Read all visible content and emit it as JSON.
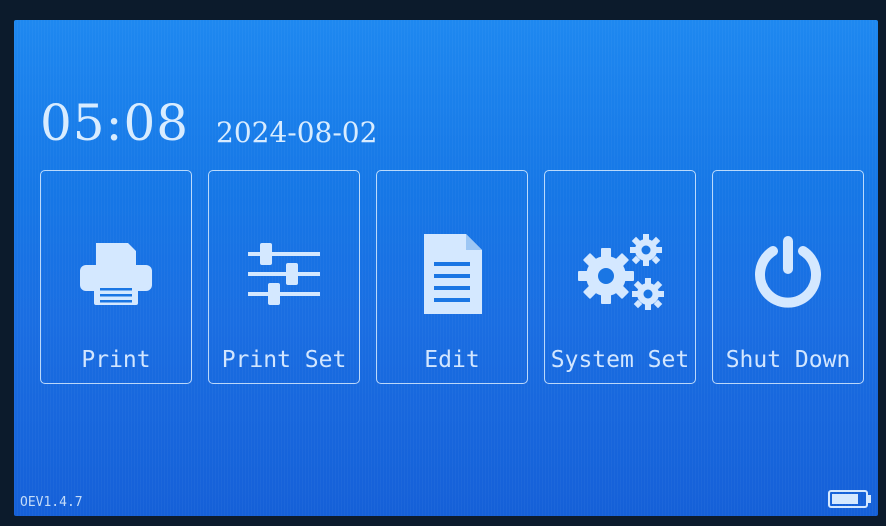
{
  "status": {
    "time": "05:08",
    "date": "2024-08-02",
    "version": "OEV1.4.7",
    "battery_icon": "battery-icon"
  },
  "menu": [
    {
      "label": "Print",
      "icon": "printer-icon"
    },
    {
      "label": "Print Set",
      "icon": "sliders-icon"
    },
    {
      "label": "Edit",
      "icon": "document-icon"
    },
    {
      "label": "System Set",
      "icon": "gears-icon"
    },
    {
      "label": "Shut Down",
      "icon": "power-icon"
    }
  ],
  "colors": {
    "screen_top": "#1e88f0",
    "screen_bottom": "#1560d8",
    "foreground": "#d8ecff"
  }
}
